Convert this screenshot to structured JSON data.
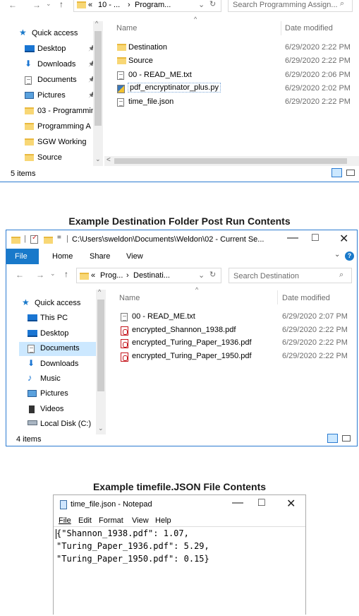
{
  "top_explorer": {
    "breadcrumb": [
      "«",
      "10 - ...",
      "›",
      "Program..."
    ],
    "search_placeholder": "Search Programming Assign...",
    "col_name": "Name",
    "col_date": "Date modified",
    "sidebar": [
      {
        "label": "Quick access",
        "icon": "star"
      },
      {
        "label": "Desktop",
        "icon": "pc",
        "pinned": true
      },
      {
        "label": "Downloads",
        "icon": "download",
        "pinned": true
      },
      {
        "label": "Documents",
        "icon": "doc",
        "pinned": true
      },
      {
        "label": "Pictures",
        "icon": "pic",
        "pinned": true
      },
      {
        "label": "03 - Programmin",
        "icon": "folder"
      },
      {
        "label": "Programming A",
        "icon": "folder"
      },
      {
        "label": "SGW Working",
        "icon": "folder"
      },
      {
        "label": "Source",
        "icon": "folder"
      }
    ],
    "files": [
      {
        "name": "Destination",
        "date": "6/29/2020 2:22 PM",
        "icon": "folder"
      },
      {
        "name": "Source",
        "date": "6/29/2020 2:22 PM",
        "icon": "folder"
      },
      {
        "name": "00 - READ_ME.txt",
        "date": "6/29/2020 2:06 PM",
        "icon": "doc"
      },
      {
        "name": "pdf_encryptinator_plus.py",
        "date": "6/29/2020 2:02 PM",
        "icon": "py"
      },
      {
        "name": "time_file.json",
        "date": "6/29/2020 2:22 PM",
        "icon": "doc"
      }
    ],
    "status": "5 items"
  },
  "heading_destination": "Example Destination Folder Post Run Contents",
  "dest_explorer": {
    "title_path": "C:\\Users\\sweldon\\Documents\\Weldon\\02 - Current Se...",
    "ribbon_tabs": [
      "File",
      "Home",
      "Share",
      "View"
    ],
    "breadcrumb": [
      "«",
      "Prog...",
      "›",
      "Destinati..."
    ],
    "search_placeholder": "Search Destination",
    "col_name": "Name",
    "col_date": "Date modified",
    "sidebar": [
      {
        "label": "Quick access",
        "icon": "star"
      },
      {
        "label": "This PC",
        "icon": "pc"
      },
      {
        "label": "Desktop",
        "icon": "pc"
      },
      {
        "label": "Documents",
        "icon": "doc",
        "selected": true
      },
      {
        "label": "Downloads",
        "icon": "download"
      },
      {
        "label": "Music",
        "icon": "music"
      },
      {
        "label": "Pictures",
        "icon": "pic"
      },
      {
        "label": "Videos",
        "icon": "vid"
      },
      {
        "label": "Local Disk (C:)",
        "icon": "disk"
      }
    ],
    "files": [
      {
        "name": "00 - READ_ME.txt",
        "date": "6/29/2020 2:07 PM",
        "icon": "doc"
      },
      {
        "name": "encrypted_Shannon_1938.pdf",
        "date": "6/29/2020 2:22 PM",
        "icon": "pdf"
      },
      {
        "name": "encrypted_Turing_Paper_1936.pdf",
        "date": "6/29/2020 2:22 PM",
        "icon": "pdf"
      },
      {
        "name": "encrypted_Turing_Paper_1950.pdf",
        "date": "6/29/2020 2:22 PM",
        "icon": "pdf"
      }
    ],
    "status": "4 items"
  },
  "heading_timefile": "Example timefile.JSON File Contents",
  "notepad": {
    "title": "time_file.json - Notepad",
    "menu": [
      "File",
      "Edit",
      "Format",
      "View",
      "Help"
    ],
    "lines": [
      "{\"Shannon_1938.pdf\": 1.07,",
      "\"Turing_Paper_1936.pdf\": 5.29,",
      "\"Turing_Paper_1950.pdf\": 0.15}"
    ]
  },
  "colors": {
    "accent": "#1979ca",
    "selection": "#cce8ff",
    "folder": "#f8d775"
  }
}
